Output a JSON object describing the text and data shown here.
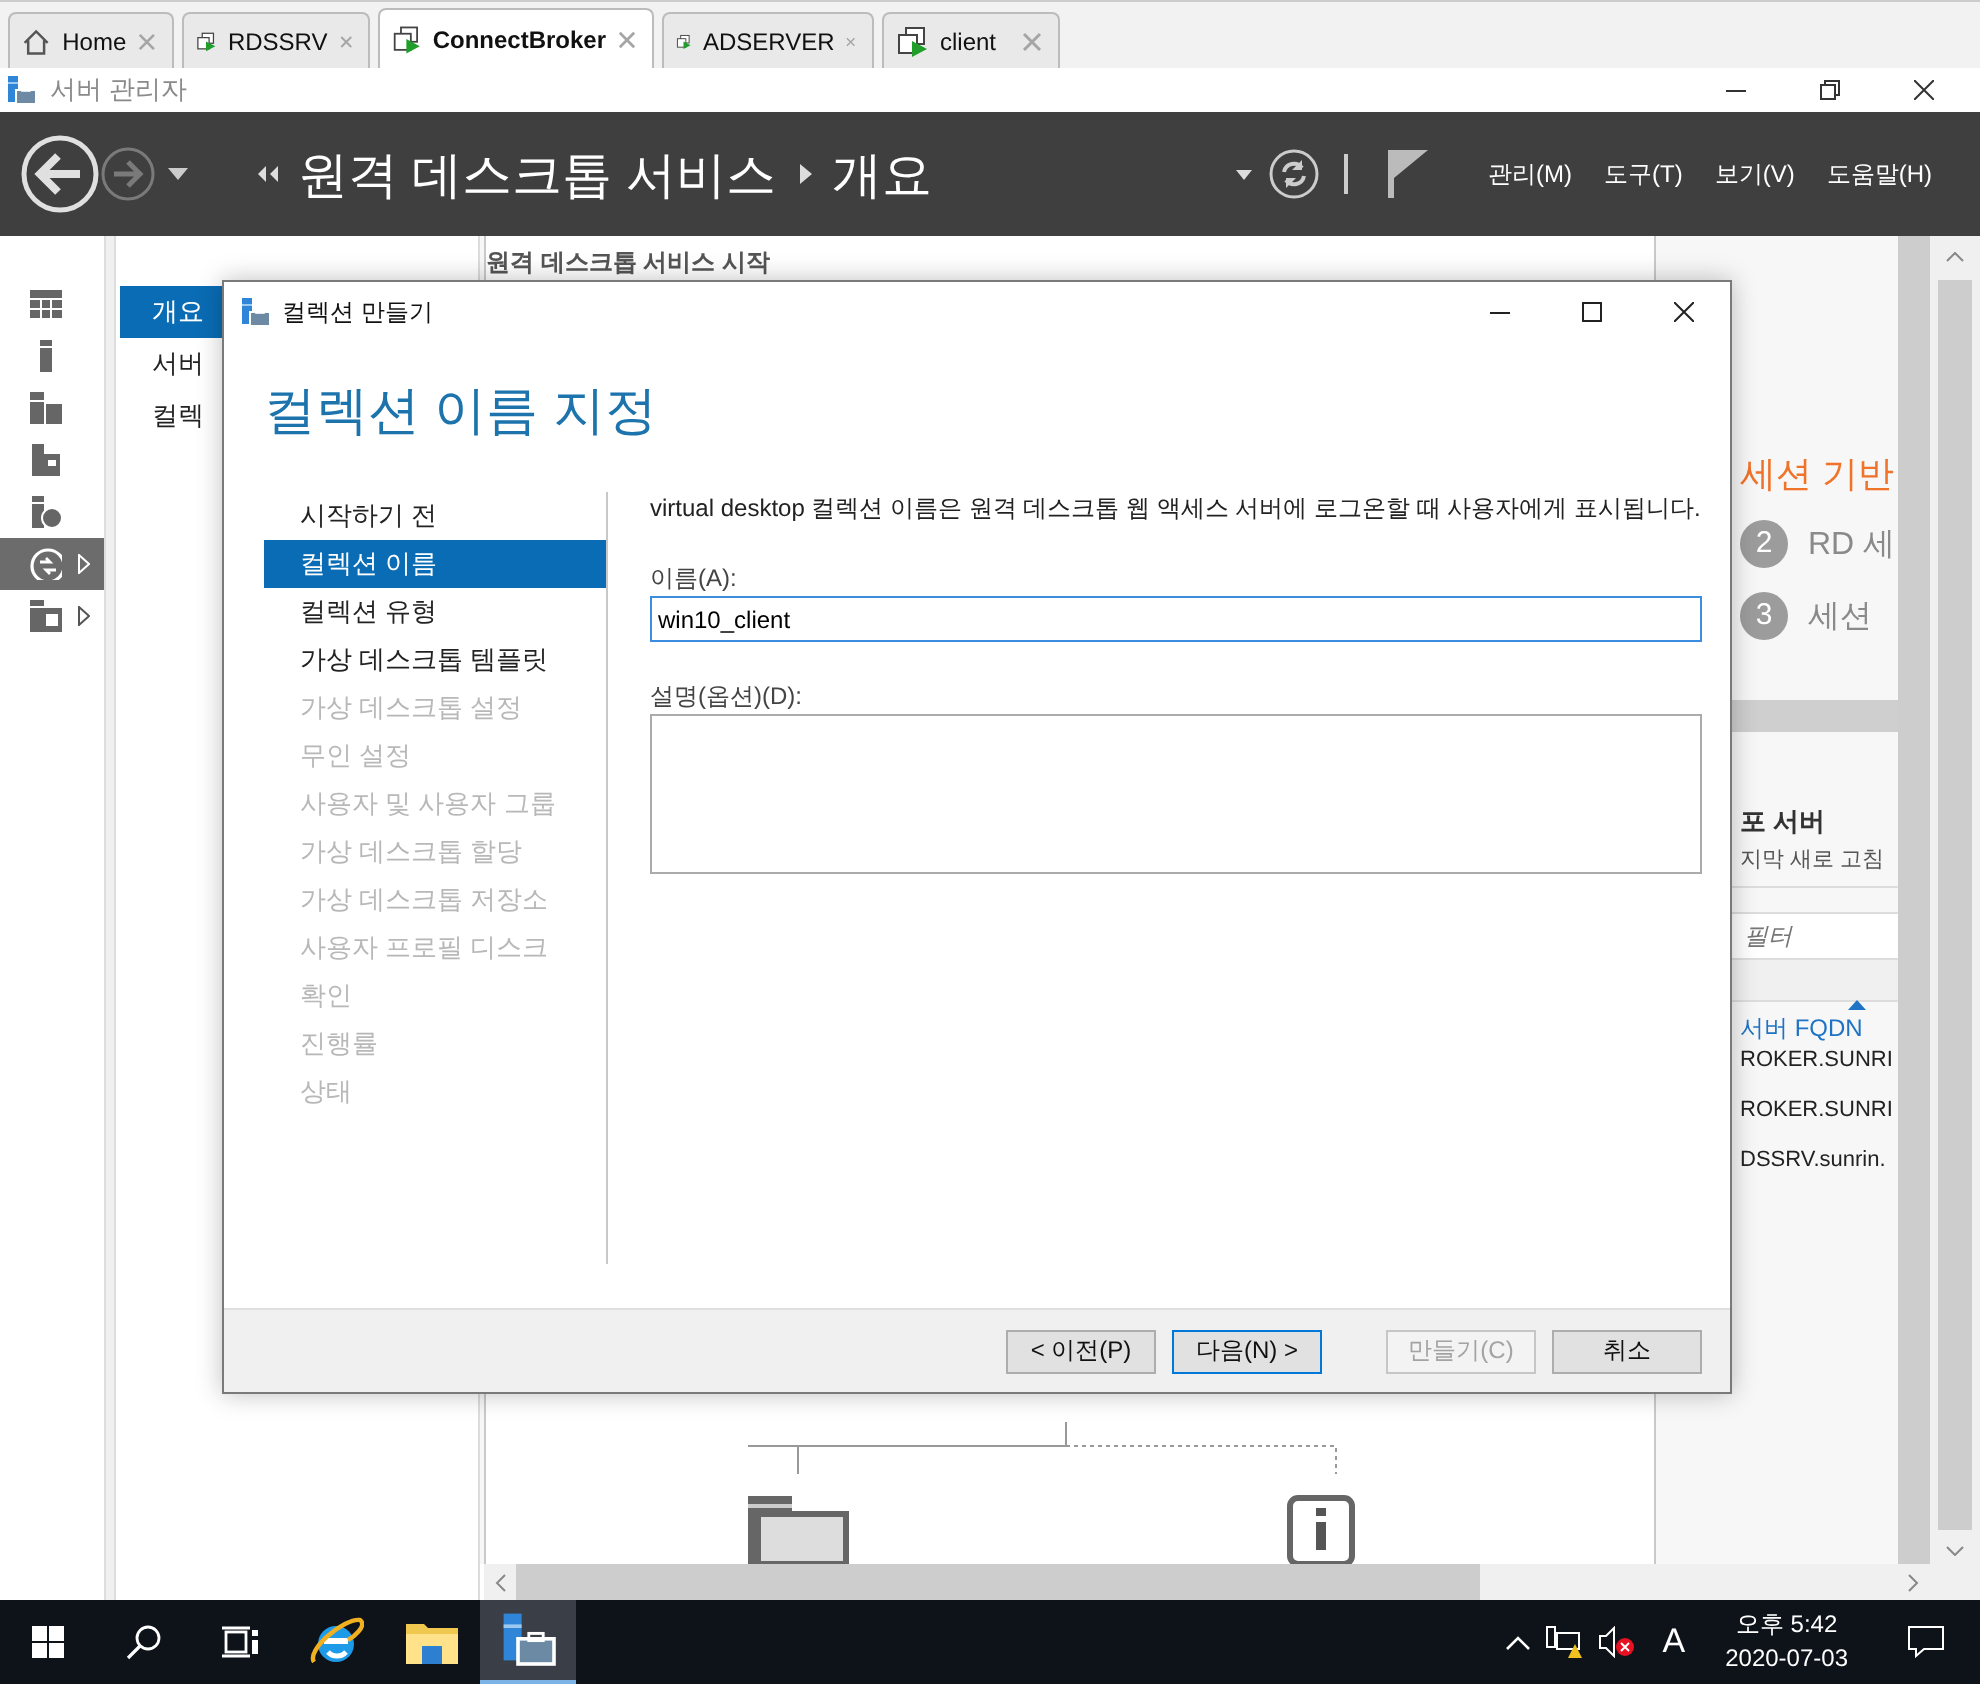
{
  "browser_tabs": [
    {
      "label": "Home",
      "kind": "home",
      "selected": false
    },
    {
      "label": "RDSSRV",
      "kind": "vm",
      "selected": false
    },
    {
      "label": "ConnectBroker",
      "kind": "vm",
      "selected": true
    },
    {
      "label": "ADSERVER",
      "kind": "vm",
      "selected": false
    },
    {
      "label": "client",
      "kind": "vm",
      "selected": false
    }
  ],
  "window": {
    "title": "서버 관리자"
  },
  "header": {
    "breadcrumb": [
      "원격 데스크톱 서비스",
      "개요"
    ],
    "menus": [
      "관리(M)",
      "도구(T)",
      "보기(V)",
      "도움말(H)"
    ]
  },
  "rail": [
    {
      "kind": "dashboard",
      "selected": false,
      "expandable": false
    },
    {
      "kind": "local",
      "selected": false,
      "expandable": false
    },
    {
      "kind": "all",
      "selected": false,
      "expandable": false
    },
    {
      "kind": "roles",
      "selected": false,
      "expandable": false
    },
    {
      "kind": "web",
      "selected": false,
      "expandable": false
    },
    {
      "kind": "rds",
      "selected": true,
      "expandable": true
    },
    {
      "kind": "files",
      "selected": false,
      "expandable": true
    }
  ],
  "nav": [
    {
      "label": "개요",
      "selected": true
    },
    {
      "label": "서버",
      "selected": false
    },
    {
      "label": "컬렉",
      "selected": false
    }
  ],
  "content": {
    "heading": "원격 데스크톱 서비스 시작",
    "steps_title": "세션 기반",
    "steps": [
      {
        "number": "2",
        "label": "RD 세"
      },
      {
        "number": "3",
        "label": "세션"
      }
    ],
    "servers": {
      "title": "포 서버",
      "subtitle": "지막 새로 고침",
      "filter_placeholder": "필터",
      "column": "서버 FQDN",
      "rows": [
        "ROKER.SUNRI",
        "ROKER.SUNRI",
        "DSSRV.sunrin."
      ]
    }
  },
  "dialog": {
    "title": "컬렉션 만들기",
    "heading": "컬렉션 이름 지정",
    "steps": [
      {
        "label": "시작하기 전",
        "selected": false,
        "disabled": false
      },
      {
        "label": "컬렉션 이름",
        "selected": true,
        "disabled": false
      },
      {
        "label": "컬렉션 유형",
        "selected": false,
        "disabled": false
      },
      {
        "label": "가상 데스크톱 템플릿",
        "selected": false,
        "disabled": false
      },
      {
        "label": "가상 데스크톱 설정",
        "selected": false,
        "disabled": true
      },
      {
        "label": "무인 설정",
        "selected": false,
        "disabled": true
      },
      {
        "label": "사용자 및 사용자 그룹",
        "selected": false,
        "disabled": true
      },
      {
        "label": "가상 데스크톱 할당",
        "selected": false,
        "disabled": true
      },
      {
        "label": "가상 데스크톱 저장소",
        "selected": false,
        "disabled": true
      },
      {
        "label": "사용자 프로필 디스크",
        "selected": false,
        "disabled": true
      },
      {
        "label": "확인",
        "selected": false,
        "disabled": true
      },
      {
        "label": "진행률",
        "selected": false,
        "disabled": true
      },
      {
        "label": "상태",
        "selected": false,
        "disabled": true
      }
    ],
    "description": "virtual desktop 컬렉션 이름은 원격 데스크톱 웹 액세스 서버에 로그온할 때 사용자에게 표시됩니다.",
    "name_label": "이름(A):",
    "name_value": "win10_client",
    "desc_label": "설명(옵션)(D):",
    "buttons": [
      {
        "label": "< 이전(P)",
        "default": false,
        "disabled": false
      },
      {
        "label": "다음(N) >",
        "default": true,
        "disabled": false
      },
      {
        "label": "만들기(C)",
        "default": false,
        "disabled": true
      },
      {
        "label": "취소",
        "default": false,
        "disabled": false
      }
    ]
  },
  "taskbar": {
    "apps": [
      {
        "kind": "ie",
        "active": false
      },
      {
        "kind": "explorer",
        "active": false
      },
      {
        "kind": "server-manager",
        "active": true
      }
    ],
    "input_indicator": "A",
    "time": "오후 5:42",
    "date": "2020-07-03"
  }
}
